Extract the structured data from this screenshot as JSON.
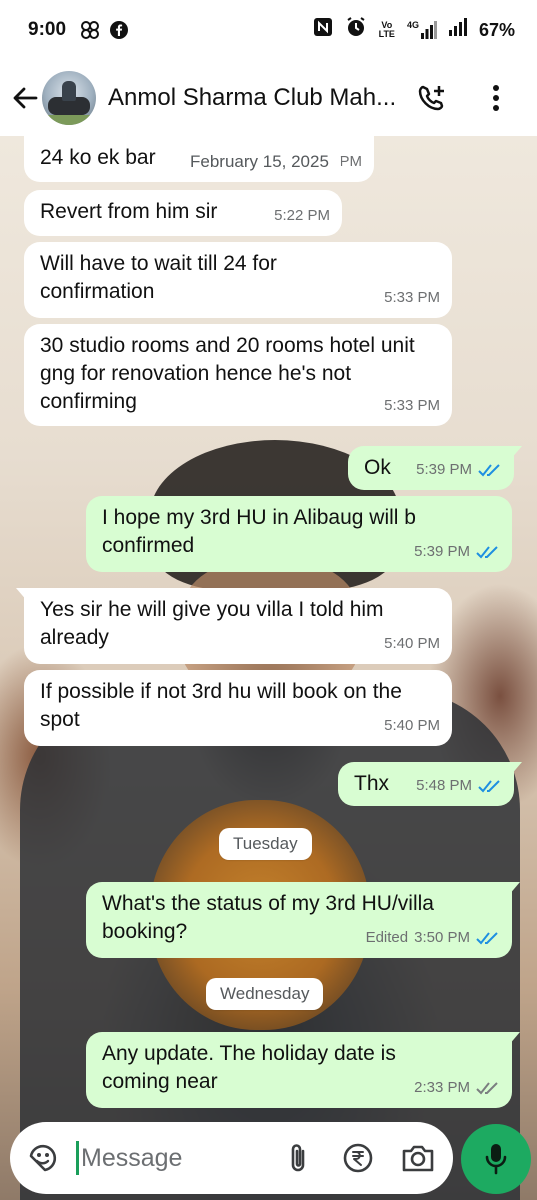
{
  "status_bar": {
    "time": "9:00",
    "carrier_label_top": "Vo",
    "carrier_label_bottom": "LTE",
    "network_label": "4G",
    "battery": "67%"
  },
  "header": {
    "title": "Anmol Sharma Club Mah..."
  },
  "floating_date": "February 15, 2025",
  "messages": [
    {
      "text": "24 ko ek bar",
      "time": "PM",
      "dir": "in"
    },
    {
      "text": "Revert from him sir",
      "time": "5:22 PM",
      "dir": "in"
    },
    {
      "text": "Will have to wait till 24 for confirmation",
      "time": "5:33 PM",
      "dir": "in"
    },
    {
      "text": "30 studio rooms and 20 rooms hotel unit gng for renovation hence he's not confirming",
      "time": "5:33 PM",
      "dir": "in"
    },
    {
      "text": "Ok",
      "time": "5:39 PM",
      "dir": "out",
      "read": true
    },
    {
      "text": "I hope my 3rd HU in Alibaug will b confirmed",
      "time": "5:39 PM",
      "dir": "out",
      "read": true
    },
    {
      "text": "Yes sir he will give you villa I told him already",
      "time": "5:40 PM",
      "dir": "in"
    },
    {
      "text": "If possible if not 3rd hu will book on the spot",
      "time": "5:40 PM",
      "dir": "in"
    },
    {
      "text": "Thx",
      "time": "5:48 PM",
      "dir": "out",
      "read": true
    },
    {
      "text": "What's the status of my 3rd HU/villa booking?",
      "time": "3:50 PM",
      "edited": "Edited",
      "dir": "out",
      "read": true
    },
    {
      "text": "Any update. The holiday date is coming near",
      "time": "2:33 PM",
      "dir": "out",
      "read": false
    }
  ],
  "day_separators": [
    "Tuesday",
    "Wednesday"
  ],
  "composer": {
    "placeholder": "Message"
  },
  "icons": {
    "back": "arrow-left-icon",
    "call": "add-call-icon",
    "menu": "more-vert-icon",
    "sticker": "sticker-icon",
    "attach": "paperclip-icon",
    "payment": "rupee-icon",
    "camera": "camera-icon",
    "mic": "microphone-icon"
  },
  "colors": {
    "outgoing_bubble": "#d8fdd2",
    "incoming_bubble": "#ffffff",
    "read_ticks": "#1e8fe1",
    "mic_button": "#1daa61"
  }
}
